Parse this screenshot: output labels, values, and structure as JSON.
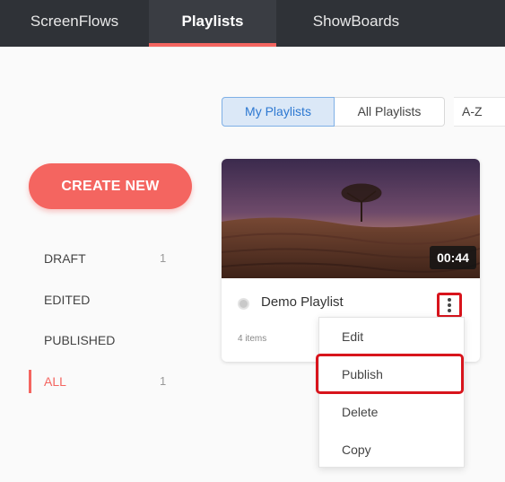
{
  "nav": {
    "tabs": [
      {
        "label": "ScreenFlows"
      },
      {
        "label": "Playlists"
      },
      {
        "label": "ShowBoards"
      }
    ],
    "active_tab": "Playlists"
  },
  "view_toggle": {
    "my_label": "My Playlists",
    "all_label": "All Playlists",
    "selected": "My Playlists"
  },
  "sort": {
    "value": "A-Z"
  },
  "create_button": {
    "label": "CREATE NEW"
  },
  "filters": [
    {
      "label": "DRAFT",
      "count": "1"
    },
    {
      "label": "EDITED",
      "count": ""
    },
    {
      "label": "PUBLISHED",
      "count": ""
    },
    {
      "label": "ALL",
      "count": "1"
    }
  ],
  "active_filter": "ALL",
  "card": {
    "title": "Demo Playlist",
    "items": "4 items",
    "duration": "00:44",
    "status": "draft"
  },
  "menu": {
    "items": [
      {
        "label": "Edit"
      },
      {
        "label": "Publish"
      },
      {
        "label": "Delete"
      },
      {
        "label": "Copy"
      }
    ],
    "highlighted": "Publish"
  },
  "colors": {
    "accent": "#f46560",
    "topbar": "#2f3237",
    "selected_blue": "#2d78d1",
    "highlight_red": "#d8141c"
  }
}
